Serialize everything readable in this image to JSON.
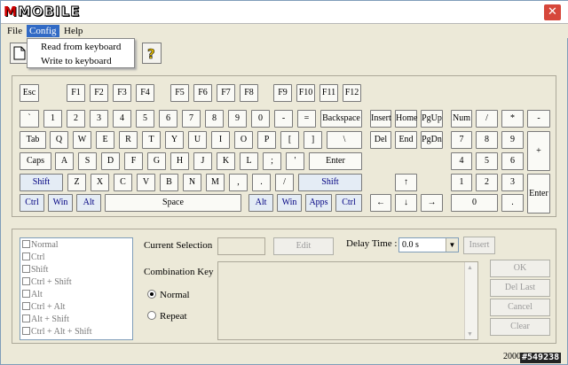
{
  "title": {
    "logo_text": "MOBILE",
    "logo_m": "M",
    "close_glyph": "✕"
  },
  "menu": {
    "file": "File",
    "config": "Config",
    "help": "Help",
    "dropdown": [
      "Read from keyboard",
      "Write to keyboard"
    ]
  },
  "keys": {
    "esc": "Esc",
    "f1": "F1",
    "f2": "F2",
    "f3": "F3",
    "f4": "F4",
    "f5": "F5",
    "f6": "F6",
    "f7": "F7",
    "f8": "F8",
    "f9": "F9",
    "f10": "F10",
    "f11": "F11",
    "f12": "F12",
    "backtick": "`",
    "n1": "1",
    "n2": "2",
    "n3": "3",
    "n4": "4",
    "n5": "5",
    "n6": "6",
    "n7": "7",
    "n8": "8",
    "n9": "9",
    "n0": "0",
    "minus": "-",
    "equal": "=",
    "backspace": "Backspace",
    "tab": "Tab",
    "q": "Q",
    "w": "W",
    "e": "E",
    "r": "R",
    "t": "T",
    "y": "Y",
    "u": "U",
    "i": "I",
    "o": "O",
    "p": "P",
    "lbracket": "[",
    "rbracket": "]",
    "backslash": "\\",
    "caps": "Caps",
    "a": "A",
    "s": "S",
    "d": "D",
    "f": "F",
    "g": "G",
    "h": "H",
    "j": "J",
    "k": "K",
    "l": "L",
    "semicolon": ";",
    "quote": "'",
    "enter": "Enter",
    "lshift": "Shift",
    "z": "Z",
    "x": "X",
    "c": "C",
    "v": "V",
    "b": "B",
    "n": "N",
    "m": "M",
    "comma": ",",
    "period": ".",
    "slash": "/",
    "rshift": "Shift",
    "lctrl": "Ctrl",
    "lwin": "Win",
    "lalt": "Alt",
    "space": "Space",
    "ralt": "Alt",
    "rwin": "Win",
    "apps": "Apps",
    "rctrl": "Ctrl",
    "insert": "Insert",
    "home": "Home",
    "pgup": "PgUp",
    "del": "Del",
    "end": "End",
    "pgdn": "PgDn",
    "up": "↑",
    "left": "←",
    "down": "↓",
    "right": "→",
    "num": "Num",
    "np_div": "/",
    "np_mul": "*",
    "np_minus": "-",
    "np7": "7",
    "np8": "8",
    "np9": "9",
    "np_plus": "+",
    "np4": "4",
    "np5": "5",
    "np6": "6",
    "np1": "1",
    "np2": "2",
    "np3": "3",
    "np_enter": "Enter",
    "np0": "0",
    "np_dot": "."
  },
  "modifiers": [
    "Normal",
    "Ctrl",
    "Shift",
    "Ctrl + Shift",
    "Alt",
    "Ctrl + Alt",
    "Alt + Shift",
    "Ctrl + Alt + Shift"
  ],
  "panel": {
    "current_selection": "Current Selection",
    "edit": "Edit",
    "delay_label": "Delay Time :",
    "delay_value": "0.0 s",
    "insert": "Insert",
    "combination_key": "Combination Key",
    "radio_normal": "Normal",
    "radio_repeat": "Repeat",
    "ok": "OK",
    "del_last": "Del Last",
    "cancel": "Cancel",
    "clear": "Clear"
  },
  "status": {
    "year": "2000",
    "watermark": "#549238"
  }
}
